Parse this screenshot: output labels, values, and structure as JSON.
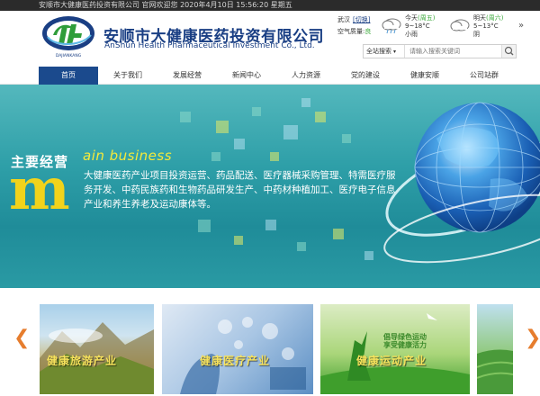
{
  "topbar": {
    "text": "安顺市大健康医药投资有限公司 官网欢迎您 2020年4月10日 15:56:20 星期五"
  },
  "header": {
    "logo_tagline": "DAJIANKANG",
    "company_cn": "安顺市大健康医药投资有限公司",
    "company_en": "AnShun Health Pharmaceutical Investment Co., Ltd."
  },
  "weather": {
    "city": "武汉",
    "switch_label": "[切换]",
    "air_label": "空气质量:",
    "air_value": "良",
    "today": {
      "label": "今天",
      "weekday": "(周五)",
      "temp": "9~18°C",
      "cond": "小雨",
      "icon": "rain-cloud-icon"
    },
    "tomorrow": {
      "label": "明天",
      "weekday": "(周六)",
      "temp": "5~13°C",
      "cond": "阴",
      "icon": "cloud-icon"
    },
    "more": "»"
  },
  "search": {
    "scope": "全站搜索",
    "placeholder": "请输入搜索关键词",
    "icon": "search-icon"
  },
  "nav": {
    "items": [
      {
        "label": "首页",
        "active": true
      },
      {
        "label": "关于我们"
      },
      {
        "label": "发展经营"
      },
      {
        "label": "新闻中心"
      },
      {
        "label": "人力资源"
      },
      {
        "label": "党的建设"
      },
      {
        "label": "健康安顺"
      },
      {
        "label": "公司站群"
      }
    ]
  },
  "banner": {
    "title_cn": "主要经营",
    "title_m": "m",
    "title_en": "ain business",
    "text": "大健康医药产业项目投资运营、药品配送、医疗器械采购管理、特需医疗服务开发、中药民族药和生物药品研发生产、中药材种植加工、医疗电子信息产业和养生养老及运动康体等。"
  },
  "carousel": {
    "prev_icon": "chevron-left-icon",
    "next_icon": "chevron-right-icon",
    "cards": [
      {
        "label": "健康旅游产业"
      },
      {
        "label": "健康医疗产业"
      },
      {
        "label": "健康运动产业",
        "slogan_1": "倡导绿色运动",
        "slogan_2": "享受健康活力"
      },
      {
        "label": ""
      }
    ]
  },
  "colors": {
    "brand_blue": "#1b4a8d",
    "banner_teal": "#2e9fa8",
    "accent_yellow": "#f2d31b",
    "arrow_orange": "#e67d2e"
  }
}
